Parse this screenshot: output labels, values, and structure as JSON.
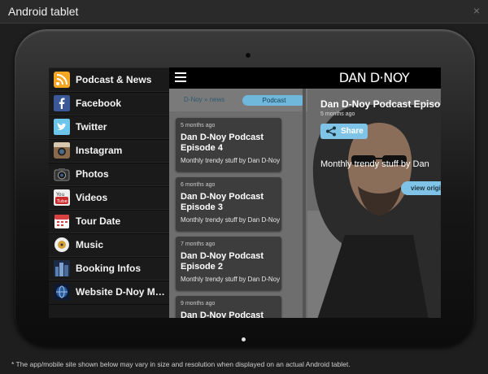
{
  "window": {
    "title": "Android tablet",
    "close_glyph": "×"
  },
  "sidebar": {
    "items": [
      {
        "label": "Podcast & News",
        "icon": "rss-icon",
        "color": "#f5a623"
      },
      {
        "label": "Facebook",
        "icon": "facebook-icon",
        "color": "#3b5998"
      },
      {
        "label": "Twitter",
        "icon": "twitter-icon",
        "color": "#6cc5ea"
      },
      {
        "label": "Instagram",
        "icon": "instagram-icon",
        "color": "#8a6a4a"
      },
      {
        "label": "Photos",
        "icon": "camera-icon",
        "color": "#222222"
      },
      {
        "label": "Videos",
        "icon": "youtube-icon",
        "color": "#cc2b2b"
      },
      {
        "label": "Tour Date",
        "icon": "calendar-icon",
        "color": "#d94040"
      },
      {
        "label": "Music",
        "icon": "vinyl-icon",
        "color": "#eeeeee"
      },
      {
        "label": "Booking Infos",
        "icon": "building-icon",
        "color": "#5a7fb0"
      },
      {
        "label": "Website D-Noy Mu...",
        "icon": "globe-icon",
        "color": "#2a5a9a"
      }
    ]
  },
  "list": {
    "breadcrumb": "D-Noy » news",
    "filter_pill": "Podcast",
    "cards": [
      {
        "age": "5 months ago",
        "title": "Dan D-Noy Podcast Episode 4",
        "desc": "Monthly trendy stuff by Dan D-Noy"
      },
      {
        "age": "6 months ago",
        "title": "Dan D-Noy Podcast Episode 3",
        "desc": "Monthly trendy stuff by Dan D-Noy"
      },
      {
        "age": "7 months ago",
        "title": "Dan D-Noy Podcast Episode 2",
        "desc": "Monthly trendy stuff by Dan D-Noy"
      },
      {
        "age": "9 months ago",
        "title": "Dan D-Noy Podcast",
        "desc": ""
      }
    ]
  },
  "detail": {
    "logo": "DAN D·NOY",
    "title": "Dan D-Noy Podcast Episod",
    "time": "5 months ago",
    "share_label": "Share",
    "description": "Monthly trendy stuff by Dan",
    "view_label": "view origi"
  },
  "footnote": "* The app/mobile site shown below may vary in size and resolution when displayed on an actual Android tablet.",
  "colors": {
    "accent": "#7fc3e6",
    "pill": "#6fb8dc",
    "card": "#3d3d3d"
  }
}
